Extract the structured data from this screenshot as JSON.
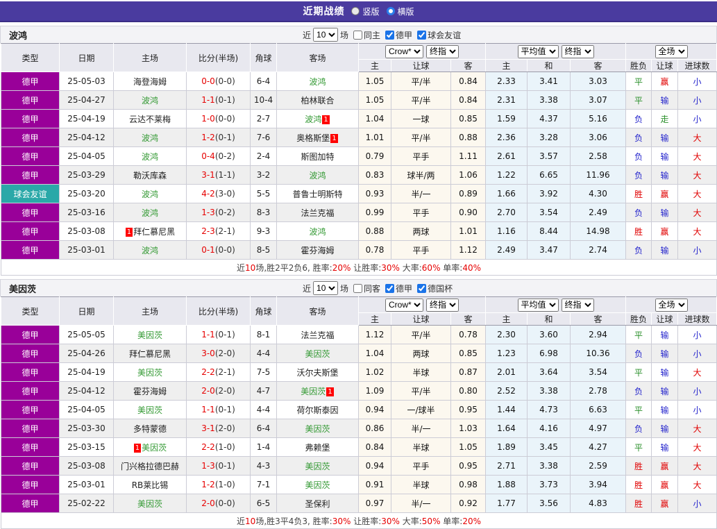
{
  "titlebar": {
    "title": "近期战绩",
    "radios": [
      {
        "label": "竖版",
        "selected": true
      },
      {
        "label": "横版",
        "selected": false
      }
    ]
  },
  "controls": {
    "near_label": "近",
    "games_value": "10",
    "games_label": "场"
  },
  "table": {
    "headers": {
      "type": "类型",
      "date": "日期",
      "home": "主场",
      "score": "比分(半场)",
      "corner": "角球",
      "away": "客场"
    },
    "selects": {
      "odds_source": "Crow*",
      "odds_index": "终指",
      "avg_source": "平均值",
      "avg_index": "终指",
      "scope": "全场"
    },
    "sub_headers": {
      "odds_home": "主",
      "odds_handicap": "让球",
      "odds_away": "客",
      "avg_home": "主",
      "avg_draw": "和",
      "avg_away": "客",
      "result": "胜负",
      "handicap": "让球",
      "goals": "进球数"
    }
  },
  "colors": {
    "titlebar_bg": "#4a3b9f",
    "league_colors": {
      "德甲": "#990099",
      "球会友谊": "#2aa8a8"
    },
    "focus_team_green": "#339933",
    "score_red": "#e60000",
    "win_red": "#e00000",
    "draw_green": "#2a8f2a",
    "loss_blue": "#2323cc"
  },
  "sections": [
    {
      "team": "波鸿",
      "filters": {
        "checks": [
          {
            "label": "同主",
            "checked": false
          },
          {
            "label": "德甲",
            "checked": true
          },
          {
            "label": "球会友谊",
            "checked": true
          }
        ]
      },
      "rows": [
        {
          "league": "德甲",
          "date": "25-05-03",
          "home": {
            "name": "海登海姆"
          },
          "score": "0-0",
          "half": "(0-0)",
          "corner": "6-4",
          "away": {
            "name": "波鸿",
            "focus": true
          },
          "odds": [
            "1.05",
            "平/半",
            "0.84"
          ],
          "avg": [
            "2.33",
            "3.41",
            "3.03"
          ],
          "result": "平",
          "handicap": "赢",
          "goals": "小"
        },
        {
          "league": "德甲",
          "date": "25-04-27",
          "home": {
            "name": "波鸿",
            "focus": true
          },
          "score": "1-1",
          "half": "(0-1)",
          "corner": "10-4",
          "away": {
            "name": "柏林联合"
          },
          "odds": [
            "1.05",
            "平/半",
            "0.84"
          ],
          "avg": [
            "2.31",
            "3.38",
            "3.07"
          ],
          "result": "平",
          "handicap": "输",
          "goals": "小"
        },
        {
          "league": "德甲",
          "date": "25-04-19",
          "home": {
            "name": "云达不莱梅"
          },
          "score": "1-0",
          "half": "(0-0)",
          "corner": "2-7",
          "away": {
            "name": "波鸿",
            "focus": true,
            "card_after": 1
          },
          "odds": [
            "1.04",
            "一球",
            "0.85"
          ],
          "avg": [
            "1.59",
            "4.37",
            "5.16"
          ],
          "result": "负",
          "handicap": "走",
          "goals": "小"
        },
        {
          "league": "德甲",
          "date": "25-04-12",
          "home": {
            "name": "波鸿",
            "focus": true
          },
          "score": "1-2",
          "half": "(0-1)",
          "corner": "7-6",
          "away": {
            "name": "奥格斯堡",
            "card_after": 1
          },
          "odds": [
            "1.01",
            "平/半",
            "0.88"
          ],
          "avg": [
            "2.36",
            "3.28",
            "3.06"
          ],
          "result": "负",
          "handicap": "输",
          "goals": "大"
        },
        {
          "league": "德甲",
          "date": "25-04-05",
          "home": {
            "name": "波鸿",
            "focus": true
          },
          "score": "0-4",
          "half": "(0-2)",
          "corner": "2-4",
          "away": {
            "name": "斯图加特"
          },
          "odds": [
            "0.79",
            "平手",
            "1.11"
          ],
          "avg": [
            "2.61",
            "3.57",
            "2.58"
          ],
          "result": "负",
          "handicap": "输",
          "goals": "大"
        },
        {
          "league": "德甲",
          "date": "25-03-29",
          "home": {
            "name": "勒沃库森"
          },
          "score": "3-1",
          "half": "(1-1)",
          "corner": "3-2",
          "away": {
            "name": "波鸿",
            "focus": true
          },
          "odds": [
            "0.83",
            "球半/两",
            "1.06"
          ],
          "avg": [
            "1.22",
            "6.65",
            "11.96"
          ],
          "result": "负",
          "handicap": "输",
          "goals": "大"
        },
        {
          "league": "球会友谊",
          "date": "25-03-20",
          "home": {
            "name": "波鸿",
            "focus": true
          },
          "score": "4-2",
          "half": "(3-0)",
          "corner": "5-5",
          "away": {
            "name": "普鲁士明斯特"
          },
          "odds": [
            "0.93",
            "半/一",
            "0.89"
          ],
          "avg": [
            "1.66",
            "3.92",
            "4.30"
          ],
          "result": "胜",
          "handicap": "赢",
          "goals": "大"
        },
        {
          "league": "德甲",
          "date": "25-03-16",
          "home": {
            "name": "波鸿",
            "focus": true
          },
          "score": "1-3",
          "half": "(0-2)",
          "corner": "8-3",
          "away": {
            "name": "法兰克福"
          },
          "odds": [
            "0.99",
            "平手",
            "0.90"
          ],
          "avg": [
            "2.70",
            "3.54",
            "2.49"
          ],
          "result": "负",
          "handicap": "输",
          "goals": "大"
        },
        {
          "league": "德甲",
          "date": "25-03-08",
          "home": {
            "name": "拜仁慕尼黑",
            "card_before": 1
          },
          "score": "2-3",
          "half": "(2-1)",
          "corner": "9-3",
          "away": {
            "name": "波鸿",
            "focus": true
          },
          "odds": [
            "0.88",
            "两球",
            "1.01"
          ],
          "avg": [
            "1.16",
            "8.44",
            "14.98"
          ],
          "result": "胜",
          "handicap": "赢",
          "goals": "大"
        },
        {
          "league": "德甲",
          "date": "25-03-01",
          "home": {
            "name": "波鸿",
            "focus": true
          },
          "score": "0-1",
          "half": "(0-0)",
          "corner": "8-5",
          "away": {
            "name": "霍芬海姆"
          },
          "odds": [
            "0.78",
            "平手",
            "1.12"
          ],
          "avg": [
            "2.49",
            "3.47",
            "2.74"
          ],
          "result": "负",
          "handicap": "输",
          "goals": "小"
        }
      ],
      "summary": [
        {
          "t": "近"
        },
        {
          "t": "10",
          "red": true
        },
        {
          "t": "场,胜2平2负6, 胜率:"
        },
        {
          "t": "20%",
          "red": true
        },
        {
          "t": " 让胜率:"
        },
        {
          "t": "30%",
          "red": true
        },
        {
          "t": " 大率:"
        },
        {
          "t": "60%",
          "red": true
        },
        {
          "t": " 单率:"
        },
        {
          "t": "40%",
          "red": true
        }
      ]
    },
    {
      "team": "美因茨",
      "filters": {
        "checks": [
          {
            "label": "同客",
            "checked": false
          },
          {
            "label": "德甲",
            "checked": true
          },
          {
            "label": "德国杯",
            "checked": true
          }
        ]
      },
      "rows": [
        {
          "league": "德甲",
          "date": "25-05-05",
          "home": {
            "name": "美因茨",
            "focus": true
          },
          "score": "1-1",
          "half": "(0-1)",
          "corner": "8-1",
          "away": {
            "name": "法兰克福"
          },
          "odds": [
            "1.12",
            "平/半",
            "0.78"
          ],
          "avg": [
            "2.30",
            "3.60",
            "2.94"
          ],
          "result": "平",
          "handicap": "输",
          "goals": "小"
        },
        {
          "league": "德甲",
          "date": "25-04-26",
          "home": {
            "name": "拜仁慕尼黑"
          },
          "score": "3-0",
          "half": "(2-0)",
          "corner": "4-4",
          "away": {
            "name": "美因茨",
            "focus": true
          },
          "odds": [
            "1.04",
            "两球",
            "0.85"
          ],
          "avg": [
            "1.23",
            "6.98",
            "10.36"
          ],
          "result": "负",
          "handicap": "输",
          "goals": "小"
        },
        {
          "league": "德甲",
          "date": "25-04-19",
          "home": {
            "name": "美因茨",
            "focus": true
          },
          "score": "2-2",
          "half": "(2-1)",
          "corner": "7-5",
          "away": {
            "name": "沃尔夫斯堡"
          },
          "odds": [
            "1.02",
            "半球",
            "0.87"
          ],
          "avg": [
            "2.01",
            "3.64",
            "3.54"
          ],
          "result": "平",
          "handicap": "输",
          "goals": "大"
        },
        {
          "league": "德甲",
          "date": "25-04-12",
          "home": {
            "name": "霍芬海姆"
          },
          "score": "2-0",
          "half": "(2-0)",
          "corner": "4-7",
          "away": {
            "name": "美因茨",
            "focus": true,
            "card_after": 1
          },
          "odds": [
            "1.09",
            "平/半",
            "0.80"
          ],
          "avg": [
            "2.52",
            "3.38",
            "2.78"
          ],
          "result": "负",
          "handicap": "输",
          "goals": "小"
        },
        {
          "league": "德甲",
          "date": "25-04-05",
          "home": {
            "name": "美因茨",
            "focus": true
          },
          "score": "1-1",
          "half": "(0-1)",
          "corner": "4-4",
          "away": {
            "name": "荷尔斯泰因"
          },
          "odds": [
            "0.94",
            "一/球半",
            "0.95"
          ],
          "avg": [
            "1.44",
            "4.73",
            "6.63"
          ],
          "result": "平",
          "handicap": "输",
          "goals": "小"
        },
        {
          "league": "德甲",
          "date": "25-03-30",
          "home": {
            "name": "多特蒙德"
          },
          "score": "3-1",
          "half": "(2-0)",
          "corner": "6-4",
          "away": {
            "name": "美因茨",
            "focus": true
          },
          "odds": [
            "0.86",
            "半/一",
            "1.03"
          ],
          "avg": [
            "1.64",
            "4.16",
            "4.97"
          ],
          "result": "负",
          "handicap": "输",
          "goals": "大"
        },
        {
          "league": "德甲",
          "date": "25-03-15",
          "home": {
            "name": "美因茨",
            "focus": true,
            "card_before": 1
          },
          "score": "2-2",
          "half": "(1-0)",
          "corner": "1-4",
          "away": {
            "name": "弗赖堡"
          },
          "odds": [
            "0.84",
            "半球",
            "1.05"
          ],
          "avg": [
            "1.89",
            "3.45",
            "4.27"
          ],
          "result": "平",
          "handicap": "输",
          "goals": "大"
        },
        {
          "league": "德甲",
          "date": "25-03-08",
          "home": {
            "name": "门兴格拉德巴赫"
          },
          "score": "1-3",
          "half": "(0-1)",
          "corner": "4-3",
          "away": {
            "name": "美因茨",
            "focus": true
          },
          "odds": [
            "0.94",
            "平手",
            "0.95"
          ],
          "avg": [
            "2.71",
            "3.38",
            "2.59"
          ],
          "result": "胜",
          "handicap": "赢",
          "goals": "大"
        },
        {
          "league": "德甲",
          "date": "25-03-01",
          "home": {
            "name": "RB莱比锡"
          },
          "score": "1-2",
          "half": "(1-0)",
          "corner": "7-1",
          "away": {
            "name": "美因茨",
            "focus": true
          },
          "odds": [
            "0.91",
            "半球",
            "0.98"
          ],
          "avg": [
            "1.88",
            "3.73",
            "3.94"
          ],
          "result": "胜",
          "handicap": "赢",
          "goals": "大"
        },
        {
          "league": "德甲",
          "date": "25-02-22",
          "home": {
            "name": "美因茨",
            "focus": true
          },
          "score": "2-0",
          "half": "(0-0)",
          "corner": "6-5",
          "away": {
            "name": "圣保利"
          },
          "odds": [
            "0.97",
            "半/一",
            "0.92"
          ],
          "avg": [
            "1.77",
            "3.56",
            "4.83"
          ],
          "result": "胜",
          "handicap": "赢",
          "goals": "小"
        }
      ],
      "summary": [
        {
          "t": "近"
        },
        {
          "t": "10",
          "red": true
        },
        {
          "t": "场,胜3平4负3, 胜率:"
        },
        {
          "t": "30%",
          "red": true
        },
        {
          "t": " 让胜率:"
        },
        {
          "t": "30%",
          "red": true
        },
        {
          "t": " 大率:"
        },
        {
          "t": "50%",
          "red": true
        },
        {
          "t": " 单率:"
        },
        {
          "t": "20%",
          "red": true
        }
      ]
    }
  ]
}
